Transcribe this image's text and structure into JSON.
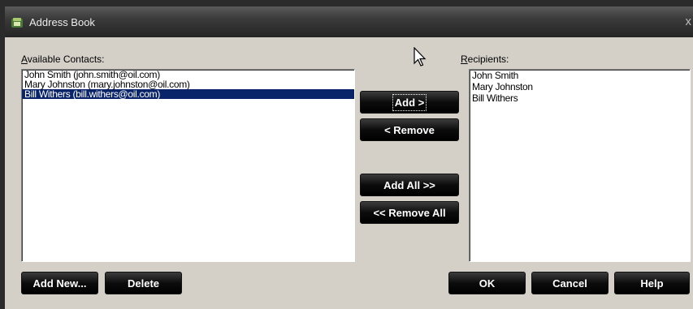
{
  "window": {
    "title": "Address Book",
    "close_glyph": "x"
  },
  "available": {
    "label_prefix": "",
    "label_accel": "A",
    "label_rest": "vailable Contacts:",
    "items": [
      "John Smith (john.smith@oil.com)",
      "Mary Johnston (mary.johnston@oil.com)",
      "Bill Withers (bill.withers@oil.com)"
    ],
    "selected_index": 2
  },
  "recipients": {
    "label_accel": "R",
    "label_rest": "ecipients:",
    "items": [
      "John Smith",
      "Mary Johnston",
      "Bill Withers"
    ]
  },
  "buttons": {
    "add": "Add >",
    "remove": "< Remove",
    "add_all": "Add All >>",
    "remove_all": "<< Remove All",
    "add_new": "Add New...",
    "delete": "Delete",
    "ok": "OK",
    "cancel": "Cancel",
    "help": "Help"
  },
  "icons": {
    "title": "address-book-icon",
    "cursor": "mouse-pointer-icon"
  },
  "colors": {
    "selection": "#0a246a",
    "dialog": "#d4d0c8",
    "button": "#000000"
  }
}
